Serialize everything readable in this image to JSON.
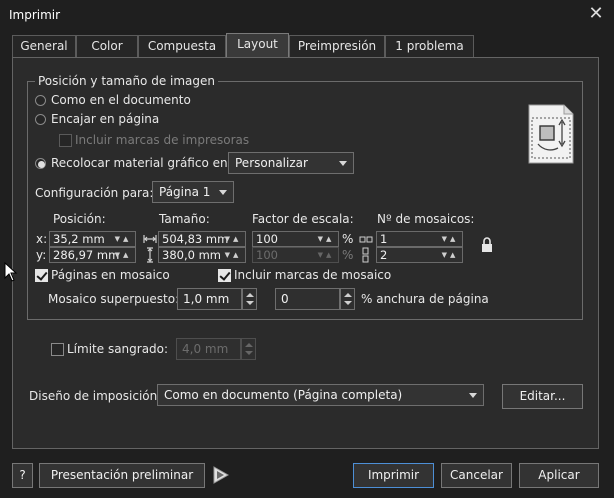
{
  "window": {
    "title": "Imprimir",
    "close": "✕"
  },
  "tabs": [
    "General",
    "Color",
    "Compuesta",
    "Layout",
    "Preimpresión",
    "1 problema"
  ],
  "group": {
    "title": "Posición y tamaño de imagen"
  },
  "options": {
    "as_document": "Como en el documento",
    "fit_page": "Encajar en página",
    "printer_marks": "Incluir marcas de impresoras",
    "reposition": "Recolocar material gráfico en",
    "reposition_value": "Personalizar"
  },
  "config": {
    "label": "Configuración para:",
    "value": "Página 1"
  },
  "headers": {
    "position": "Posición:",
    "size": "Tamaño:",
    "scale": "Factor de escala:",
    "tiles": "Nº de mosaicos:"
  },
  "axes": {
    "x": "x:",
    "y": "y:"
  },
  "values": {
    "pos_x": "35,2 mm",
    "pos_y": "286,97 mm",
    "size_w": "504,83 mm",
    "size_h": "380,0 mm",
    "scale_x": "100",
    "scale_y": "100",
    "percent": "%",
    "tiles_x": "1",
    "tiles_y": "2"
  },
  "tiling": {
    "tile_pages": "Páginas en mosaico",
    "tile_marks": "Incluir marcas de mosaico",
    "overlap_label": "Mosaico superpuesto:",
    "overlap_value": "1,0 mm",
    "overlap_pct": "0",
    "overlap_suffix": "% anchura de página"
  },
  "bleed": {
    "label": "Límite sangrado:",
    "value": "4,0 mm"
  },
  "imposition": {
    "label": "Diseño de imposición:",
    "value": "Como en documento (Página completa)",
    "edit": "Editar..."
  },
  "footer": {
    "help": "?",
    "preview": "Presentación preliminar",
    "print": "Imprimir",
    "cancel": "Cancelar",
    "apply": "Aplicar"
  }
}
